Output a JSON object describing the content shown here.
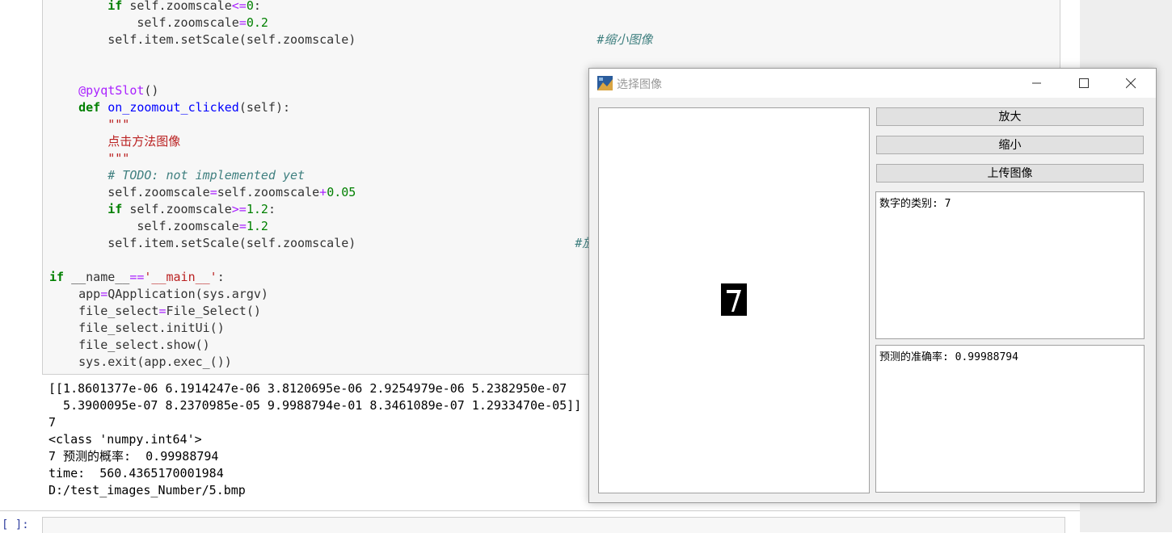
{
  "code_cell": {
    "lines": [
      {
        "indent": "        ",
        "parts": [
          {
            "t": "if",
            "c": "kw"
          },
          {
            "t": " self.zoomscale"
          },
          {
            "t": "<=",
            "c": "op"
          },
          {
            "t": "0",
            "c": "num"
          },
          {
            "t": ":"
          }
        ]
      },
      {
        "indent": "            ",
        "parts": [
          {
            "t": "self.zoomscale"
          },
          {
            "t": "=",
            "c": "op"
          },
          {
            "t": "0.2",
            "c": "num"
          }
        ]
      },
      {
        "indent": "        ",
        "parts": [
          {
            "t": "self.item.setScale(self.zoomscale)"
          },
          {
            "t": "                                 "
          },
          {
            "t": "#缩小图像",
            "c": "cm"
          }
        ]
      },
      {
        "indent": "",
        "parts": []
      },
      {
        "indent": "",
        "parts": []
      },
      {
        "indent": "    ",
        "parts": [
          {
            "t": "@pyqtSlot",
            "c": "dec"
          },
          {
            "t": "()"
          }
        ]
      },
      {
        "indent": "    ",
        "parts": [
          {
            "t": "def",
            "c": "kw"
          },
          {
            "t": " "
          },
          {
            "t": "on_zoomout_clicked",
            "c": "fn"
          },
          {
            "t": "(self):"
          }
        ]
      },
      {
        "indent": "        ",
        "parts": [
          {
            "t": "\"\"\"",
            "c": "str"
          }
        ]
      },
      {
        "indent": "        ",
        "parts": [
          {
            "t": "点击方法图像",
            "c": "str"
          }
        ]
      },
      {
        "indent": "        ",
        "parts": [
          {
            "t": "\"\"\"",
            "c": "str"
          }
        ]
      },
      {
        "indent": "        ",
        "parts": [
          {
            "t": "# TODO: not implemented yet",
            "c": "cm"
          }
        ]
      },
      {
        "indent": "        ",
        "parts": [
          {
            "t": "self.zoomscale"
          },
          {
            "t": "=",
            "c": "op"
          },
          {
            "t": "self.zoomscale"
          },
          {
            "t": "+",
            "c": "op"
          },
          {
            "t": "0.05",
            "c": "num"
          }
        ]
      },
      {
        "indent": "        ",
        "parts": [
          {
            "t": "if",
            "c": "kw"
          },
          {
            "t": " self.zoomscale"
          },
          {
            "t": ">=",
            "c": "op"
          },
          {
            "t": "1.2",
            "c": "num"
          },
          {
            "t": ":"
          }
        ]
      },
      {
        "indent": "            ",
        "parts": [
          {
            "t": "self.zoomscale"
          },
          {
            "t": "=",
            "c": "op"
          },
          {
            "t": "1.2",
            "c": "num"
          }
        ]
      },
      {
        "indent": "        ",
        "parts": [
          {
            "t": "self.item.setScale(self.zoomscale)"
          },
          {
            "t": "                              "
          },
          {
            "t": "#放",
            "c": "cm"
          }
        ]
      },
      {
        "indent": "",
        "parts": []
      },
      {
        "indent": "",
        "parts": [
          {
            "t": "if",
            "c": "kw"
          },
          {
            "t": " __name__"
          },
          {
            "t": "==",
            "c": "op"
          },
          {
            "t": "'__main__'",
            "c": "str"
          },
          {
            "t": ":"
          }
        ]
      },
      {
        "indent": "    ",
        "parts": [
          {
            "t": "app"
          },
          {
            "t": "=",
            "c": "op"
          },
          {
            "t": "QApplication(sys.argv)"
          }
        ]
      },
      {
        "indent": "    ",
        "parts": [
          {
            "t": "file_select"
          },
          {
            "t": "=",
            "c": "op"
          },
          {
            "t": "File_Select()"
          }
        ]
      },
      {
        "indent": "    ",
        "parts": [
          {
            "t": "file_select.initUi()"
          }
        ]
      },
      {
        "indent": "    ",
        "parts": [
          {
            "t": "file_select.show()"
          }
        ]
      },
      {
        "indent": "    ",
        "parts": [
          {
            "t": "sys.exit(app.exec_())"
          }
        ]
      }
    ]
  },
  "output": {
    "lines": [
      "[[1.8601377e-06 6.1914247e-06 3.8120695e-06 2.9254979e-06 5.2382950e-07",
      "  5.3900095e-07 8.2370985e-05 9.9988794e-01 8.3461089e-07 1.2933470e-05]]",
      "7",
      "<class 'numpy.int64'>",
      "7 预测的概率:  0.99988794",
      "time:  560.4365170001984",
      "D:/test_images_Number/5.bmp"
    ]
  },
  "next_cell": {
    "prompt": "[ ]:"
  },
  "window": {
    "title": "选择图像",
    "zoom_in_label": "放大",
    "zoom_out_label": "缩小",
    "upload_label": "上传图像",
    "class_text": "数字的类别: 7",
    "accuracy_text": "预测的准确率: 0.99988794"
  }
}
